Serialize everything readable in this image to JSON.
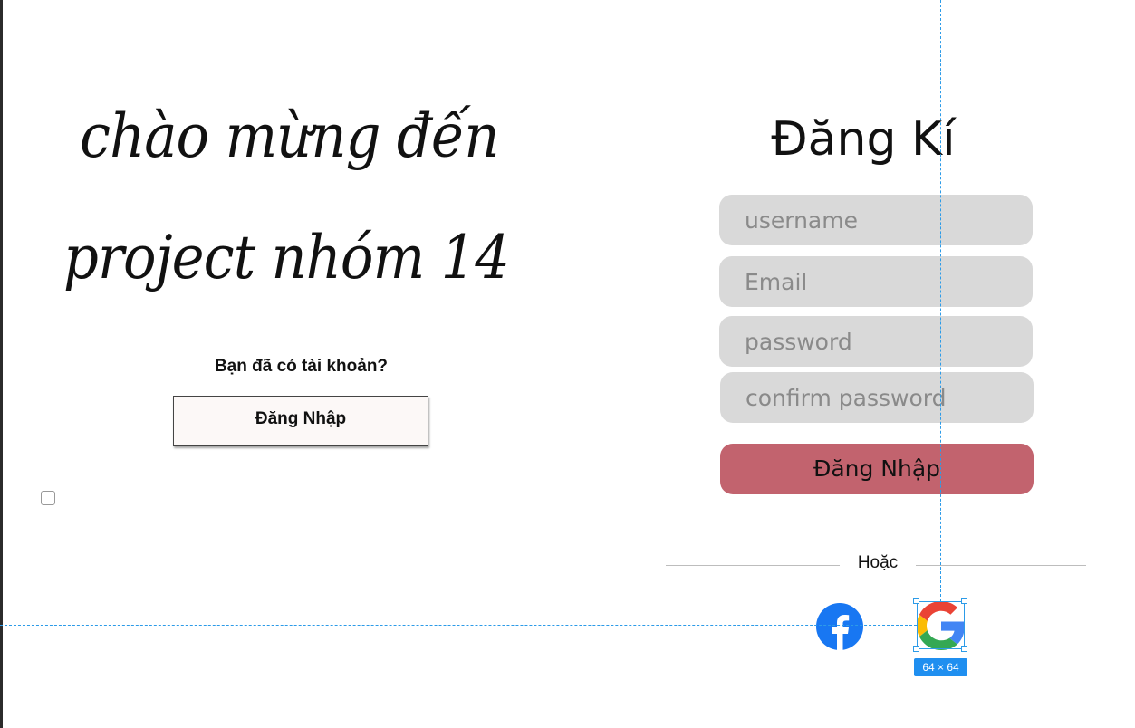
{
  "welcome": {
    "line1": "chào mừng đến",
    "line2": "project nhóm 14"
  },
  "login_prompt": {
    "question": "Bạn đã có tài khoản?",
    "button_label": "Đăng Nhập"
  },
  "register": {
    "title": "Đăng Kí",
    "fields": {
      "username_placeholder": "username",
      "email_placeholder": "Email",
      "password_placeholder": "password",
      "confirm_placeholder": "confirm password"
    },
    "submit_label": "Đăng Nhập",
    "or_text": "Hoặc",
    "social": {
      "facebook_icon": "facebook-icon",
      "google_icon": "google-icon"
    }
  },
  "editor_overlay": {
    "selection_size": "64 × 64"
  },
  "colors": {
    "field_bg": "#d9d9d9",
    "submit_bg": "#c2636e",
    "facebook_blue": "#1877f2",
    "selection_blue": "#2c9be8"
  }
}
